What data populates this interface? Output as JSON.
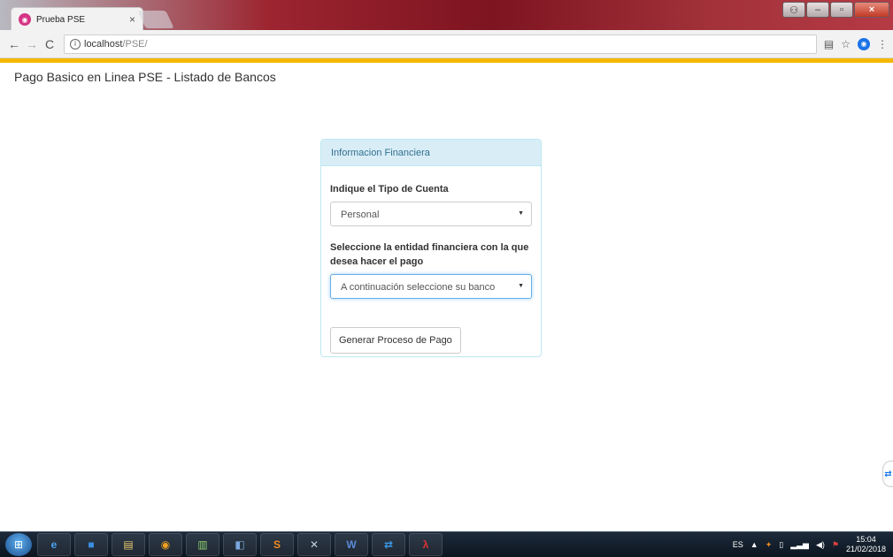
{
  "browser": {
    "tab_title": "Prueba PSE",
    "tab_close": "×",
    "url_host": "localhost",
    "url_path": "/PSE/",
    "back": "←",
    "forward": "→",
    "reload": "C"
  },
  "page": {
    "title": "Pago Basico en Linea PSE - Listado de Bancos"
  },
  "panel": {
    "heading": "Informacion Financiera",
    "account_type_label": "Indique el Tipo de Cuenta",
    "account_type_value": "Personal",
    "bank_label": "Seleccione la entidad financiera con la que desea hacer el pago",
    "bank_value": "A continuación seleccione su banco",
    "submit_label": "Generar Proceso de Pago"
  },
  "taskbar": {
    "language": "ES",
    "time": "15:04",
    "date": "21/02/2018",
    "apps": [
      "ie-icon",
      "media-icon",
      "files-icon",
      "chrome-icon",
      "chart-icon",
      "folder-icon",
      "sublime-icon",
      "tools-icon",
      "word-icon",
      "teamviewer-icon",
      "acrobat-icon"
    ]
  },
  "colors": {
    "panel_heading_bg": "#d9edf7",
    "panel_heading_text": "#31708f",
    "accent_bar": "#f5b800"
  }
}
